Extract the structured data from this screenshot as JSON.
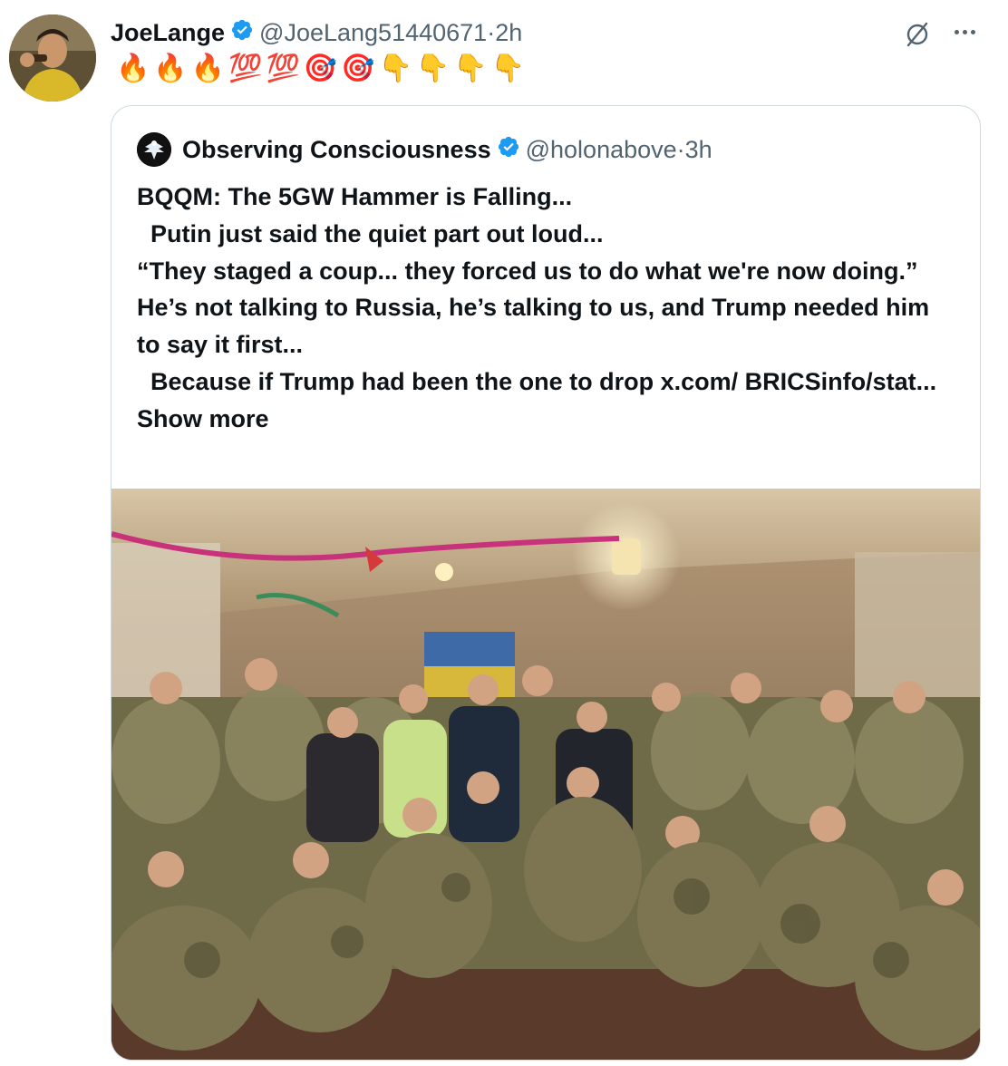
{
  "tweet": {
    "author_name": "JoeLange",
    "handle": "@JoeLang51440671",
    "separator": "·",
    "time": "2h",
    "emojis": [
      "🔥",
      "🔥",
      "🔥",
      "💯",
      "💯",
      "🎯",
      "🎯",
      "👇",
      "👇",
      "👇",
      "👇"
    ]
  },
  "quoted": {
    "author_name": "Observing Consciousness",
    "handle": "@holonabove",
    "separator": "·",
    "time": "3h",
    "lines": [
      "BQQM: The 5GW Hammer is Falling...",
      "  Putin just said the quiet part out loud...",
      "“They staged a coup... they forced us to do what we're now doing.”",
      "He’s not talking to Russia, he’s talking to us, and Trump needed him to say it first...",
      "  Because if Trump had been the one to drop x.com/ BRICSinfo/stat..."
    ],
    "show_more": "Show more"
  },
  "colors": {
    "verified": "#1d9bf0",
    "secondary_text": "#536471",
    "border": "#cfd9de"
  },
  "icons": {
    "verified": "verified-badge-icon",
    "grok": "grok-slash-icon",
    "more": "more-dots-icon"
  }
}
